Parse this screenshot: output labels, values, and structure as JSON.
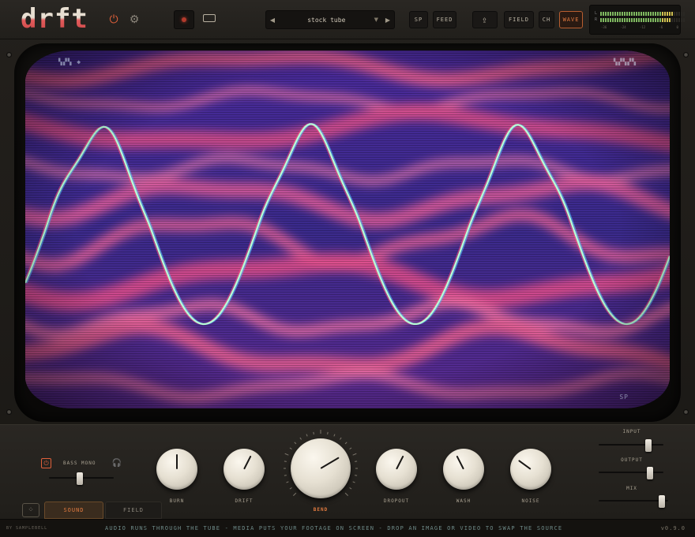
{
  "app": {
    "logo": "drft"
  },
  "toolbar": {
    "preset_name": "stock tube",
    "prev_glyph": "◀",
    "next_glyph": "▶",
    "caret_glyph": "▼",
    "sp_label": "SP",
    "feed_label": "FEED",
    "export_glyph": "⇪",
    "field_label": "FIELD",
    "ch_label": "CH",
    "wave_label": "WAVE",
    "power_glyph": "⏻",
    "gear_glyph": "⚙"
  },
  "meter": {
    "left_label": "L",
    "right_label": "R",
    "scale": [
      "-36",
      "-24",
      "-12",
      "-6",
      "0"
    ],
    "left_level": 0.86,
    "right_level": 0.84
  },
  "screen": {
    "corner_tl": "▚▞▚ ◆",
    "corner_tr": "▚▞▚▞▚",
    "corner_br": "SP"
  },
  "controls": {
    "bass_mono": {
      "label": "BASS MONO",
      "power_glyph": "⏻",
      "headphones_glyph": "🎧",
      "value": 0.47
    },
    "knobs": [
      {
        "id": "burn",
        "label": "BURN",
        "value": 0.5
      },
      {
        "id": "drift",
        "label": "DRIFT",
        "value": 0.6
      },
      {
        "id": "bend",
        "label": "BEND",
        "value": 0.72
      },
      {
        "id": "dropout",
        "label": "DROPOUT",
        "value": 0.6
      },
      {
        "id": "wash",
        "label": "WASH",
        "value": 0.4
      },
      {
        "id": "noise",
        "label": "NOISE",
        "value": 0.3
      }
    ],
    "input": {
      "label": "INPUT",
      "value": 0.8
    },
    "output": {
      "label": "OUTPUT",
      "value": 0.82
    },
    "mix": {
      "label": "MIX",
      "value": 0.95
    }
  },
  "tabs": {
    "icon_glyph": "⁘",
    "sound": "SOUND",
    "field": "FIELD"
  },
  "footer": {
    "brand": "BY SAMPLEBELL",
    "message": "AUDIO RUNS THROUGH THE TUBE  -  MEDIA PUTS YOUR FOOTAGE ON SCREEN  -  DROP AN IMAGE OR VIDEO TO SWAP THE SOURCE",
    "version": "v0.9.0"
  },
  "colors": {
    "accent": "#e07a40",
    "wave": "#9ff0c8",
    "screen_pink": "#f06090",
    "screen_purple": "#3a2a8c"
  }
}
